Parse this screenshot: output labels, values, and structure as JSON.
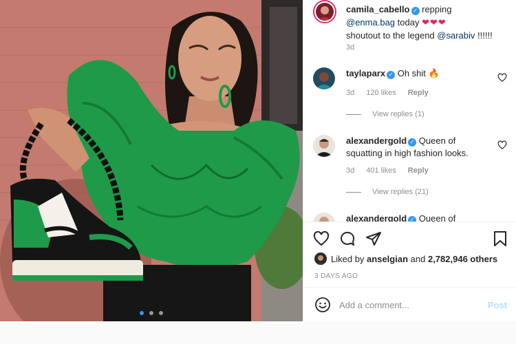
{
  "caption": {
    "username": "camila_cabello",
    "text_before": "repping",
    "mention1": "@enma.bag",
    "text_mid": "today",
    "hearts": "❤❤❤",
    "text_line2": "shoutout to the legend",
    "mention2": "@sarabiv",
    "text_after": "!!!!!!",
    "time": "3d"
  },
  "comments": [
    {
      "username": "taylaparx",
      "text": "Oh shit 🔥",
      "time": "3d",
      "likes": "120 likes",
      "reply_label": "Reply",
      "view_replies": "View replies (1)"
    },
    {
      "username": "alexandergold",
      "text": "Queen of squatting in high fashion looks.",
      "time": "3d",
      "likes": "401 likes",
      "reply_label": "Reply",
      "view_replies": "View replies (21)"
    },
    {
      "username": "alexandergold",
      "text": "Queen of"
    }
  ],
  "actions": {
    "like_icon": "heart-outline-icon",
    "comment_icon": "speech-bubble-icon",
    "share_icon": "paper-plane-icon",
    "save_icon": "bookmark-icon",
    "liked_by_prefix": "Liked by",
    "liked_by_user": "anselgian",
    "liked_by_conj": "and",
    "liked_by_count": "2,782,946 others",
    "post_date": "3 DAYS AGO"
  },
  "add_comment": {
    "placeholder": "Add a comment...",
    "post_label": "Post"
  },
  "carousel": {
    "total": 3,
    "active_index": 0
  },
  "colors": {
    "verified": "#3897f0",
    "mention": "#00376b",
    "post_disabled": "#b2dffc",
    "muted": "#8e8e8e"
  }
}
